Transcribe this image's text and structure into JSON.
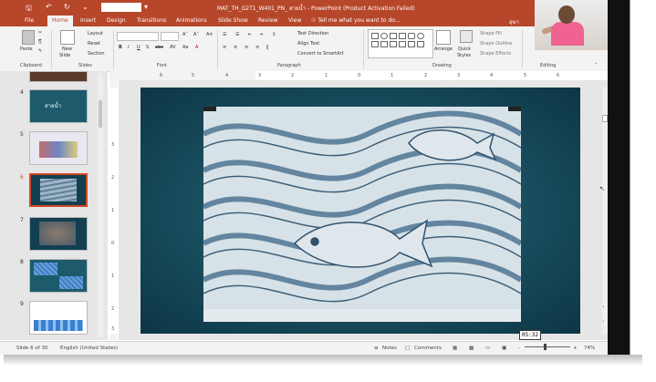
{
  "window": {
    "title": "MAT_TH_G2T1_W401_PN_ สายน้ำ - PowerPoint (Product Activation Failed)",
    "user": "อุษา"
  },
  "tabs": [
    "File",
    "Home",
    "Insert",
    "Design",
    "Transitions",
    "Animations",
    "Slide Show",
    "Review",
    "View"
  ],
  "tell_me": "Tell me what you want to do...",
  "ribbon": {
    "clipboard": {
      "label": "Clipboard",
      "paste": "Paste"
    },
    "slides": {
      "label": "Slides",
      "new_slide": "New",
      "new_slide2": "Slide",
      "layout": "Layout",
      "reset": "Reset",
      "section": "Section"
    },
    "font": {
      "label": "Font"
    },
    "paragraph": {
      "label": "Paragraph",
      "text_direction": "Text Direction",
      "align_text": "Align Text",
      "convert": "Convert to SmartArt"
    },
    "drawing": {
      "label": "Drawing",
      "arrange": "Arrange",
      "quick": "Quick",
      "styles": "Styles",
      "fill": "Shape Fill",
      "outline": "Shape Outline",
      "effects": "Shape Effects"
    },
    "editing": {
      "label": "Editing"
    }
  },
  "ruler_top": [
    "6",
    "5",
    "4",
    "3",
    "2",
    "1",
    "0",
    "1",
    "2",
    "3",
    "4",
    "5",
    "6"
  ],
  "ruler_left": [
    "3",
    "2",
    "1",
    "0",
    "1",
    "2",
    "3"
  ],
  "thumbnails": [
    {
      "num": "4",
      "title": "สายน้ำ"
    },
    {
      "num": "5",
      "title": ""
    },
    {
      "num": "6",
      "title": ""
    },
    {
      "num": "7",
      "title": ""
    },
    {
      "num": "8",
      "title": ""
    },
    {
      "num": "9",
      "title": ""
    }
  ],
  "status": {
    "slide": "Slide 6 of 30",
    "language": "English (United States)",
    "notes": "Notes",
    "comments": "Comments",
    "zoom": "74%",
    "zoom_minus": "-",
    "zoom_plus": "+"
  },
  "timer": "05:32",
  "colors": {
    "accent": "#b7472a",
    "slide_bg": "#174a5b",
    "selected_thumb": "#d24726"
  }
}
